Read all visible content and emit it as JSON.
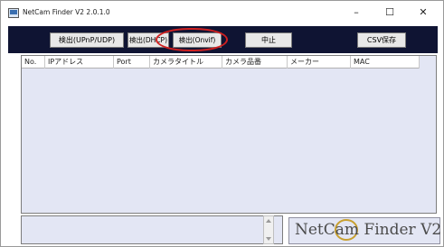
{
  "window": {
    "title": "NetCam Finder V2  2.0.1.0",
    "controls": {
      "minimize": "–",
      "maximize": "☐",
      "close": "✕"
    }
  },
  "toolbar": {
    "upnp_label": "検出(UPnP/UDP)",
    "dhcp_label": "検出(DHCP)",
    "onvif_label": "検出(Onvif)",
    "stop_label": "中止",
    "csv_label": "CSV保存",
    "highlight_color": "#d02020",
    "background_color": "#0f1433"
  },
  "table": {
    "columns": [
      "No.",
      "IPアドレス",
      "Port",
      "カメラタイトル",
      "カメラ品番",
      "メーカー",
      "MAC"
    ],
    "rows": []
  },
  "log": {
    "text": ""
  },
  "logo": {
    "text": "NetCam Finder V2"
  }
}
